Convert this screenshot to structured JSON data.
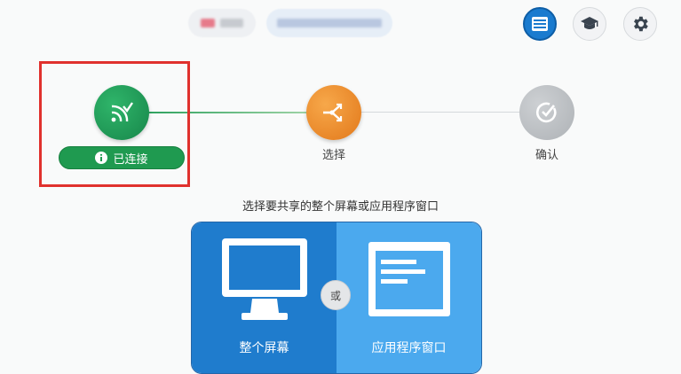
{
  "steps": [
    {
      "label": "",
      "status": "已连接",
      "icon": "connected-signal-icon",
      "color": "#1e9e5f"
    },
    {
      "label": "选择",
      "icon": "share-arrows-icon",
      "color": "#f0902c"
    },
    {
      "label": "确认",
      "icon": "check-circle-icon",
      "color": "#b8bcc0"
    }
  ],
  "prompt": "选择要共享的整个屏幕或应用程序窗口",
  "options": {
    "screen_label": "整个屏幕",
    "or_label": "或",
    "window_label": "应用程序窗口"
  },
  "top_icons": [
    "list-menu-icon",
    "graduation-cap-icon",
    "gear-icon"
  ],
  "colors": {
    "accent_blue": "#1c74c2",
    "screen_panel": "#1f7ccd",
    "window_panel": "#4ba9ee",
    "highlight": "#e0312d"
  }
}
